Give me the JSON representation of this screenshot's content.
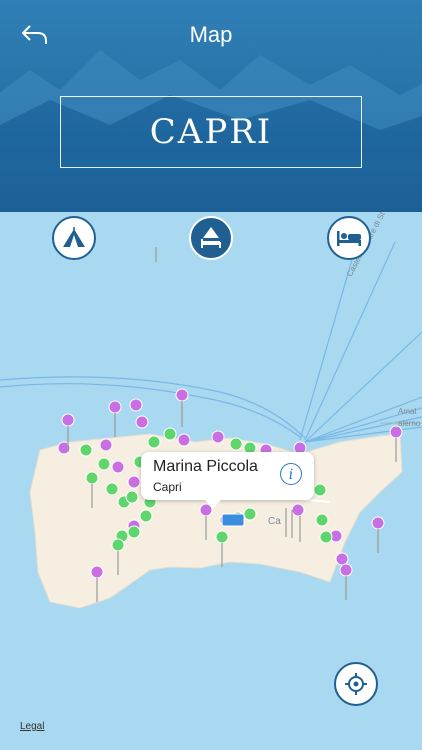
{
  "nav": {
    "title": "Map"
  },
  "banner": {
    "title": "CAPRI"
  },
  "categories": [
    {
      "name": "tent",
      "icon": "tent-icon",
      "active": false
    },
    {
      "name": "camp-hotel",
      "icon": "camp-bed-icon",
      "active": true
    },
    {
      "name": "hotel",
      "icon": "bed-icon",
      "active": false
    }
  ],
  "map": {
    "road_labels": {
      "castellammare": "Castellammare di St",
      "amal": "Amal",
      "salerno": "alerno"
    },
    "town_label": "Ca",
    "callout": {
      "title": "Marina Piccola",
      "subtitle": "Capri"
    },
    "legal": "Legal"
  },
  "colors": {
    "sea": "#a9d8f1",
    "land": "#f6efe1",
    "header": "#1f69a1",
    "pin_green": "#5fd66b",
    "pin_purple": "#c96fe3"
  }
}
